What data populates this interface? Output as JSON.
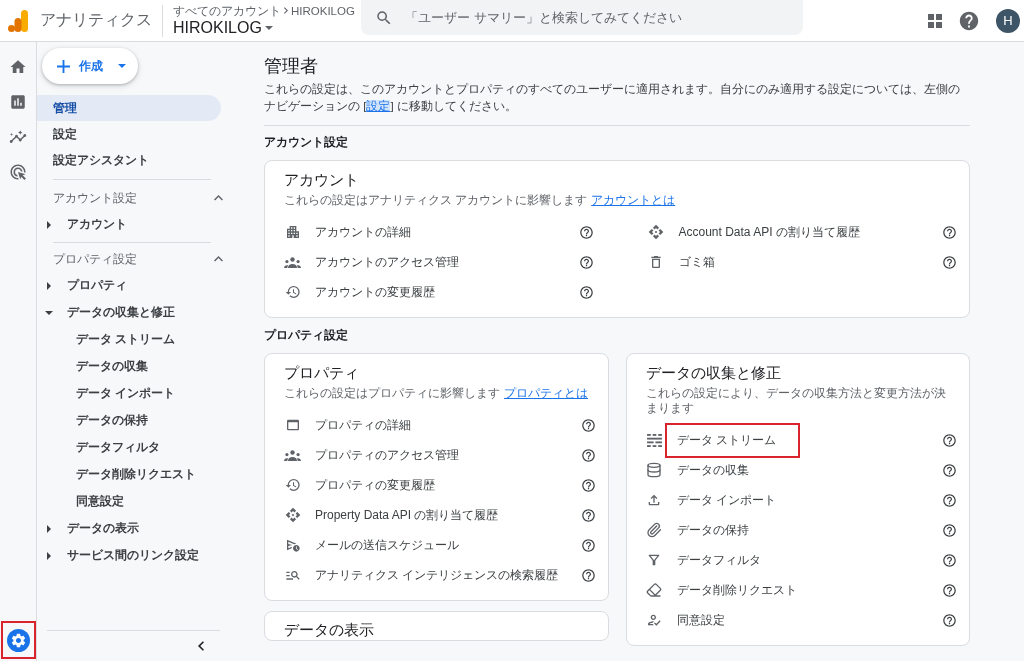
{
  "header": {
    "product": "アナリティクス",
    "breadcrumb": [
      "すべてのアカウント",
      "HIROKILOG"
    ],
    "property": "HIROKILOG",
    "search": {
      "placeholder": "「ユーザー サマリー」と検索してみてください"
    },
    "avatar": "H"
  },
  "rail": {
    "items": [
      {
        "kind": "home",
        "selected": false
      },
      {
        "kind": "reports",
        "selected": false
      },
      {
        "kind": "explore",
        "selected": false
      },
      {
        "kind": "advertising",
        "selected": false
      }
    ],
    "admin": {
      "selected": true,
      "highlighted": true
    }
  },
  "sidebar": {
    "create_button": "作成",
    "nav": [
      {
        "label": "管理",
        "selected": true
      },
      {
        "label": "設定",
        "selected": false
      },
      {
        "label": "設定アシスタント",
        "selected": false
      }
    ],
    "sections": [
      {
        "title": "アカウント設定",
        "expanded": true,
        "items": [
          {
            "label": "アカウント",
            "expanded": false
          }
        ]
      },
      {
        "title": "プロパティ設定",
        "expanded": true,
        "items": [
          {
            "label": "プロパティ",
            "expanded": false
          },
          {
            "label": "データの収集と修正",
            "expanded": true,
            "children": [
              {
                "label": "データ ストリーム",
                "selected": false
              },
              {
                "label": "データの収集",
                "selected": false
              },
              {
                "label": "データ インポート",
                "selected": false
              },
              {
                "label": "データの保持",
                "selected": false
              },
              {
                "label": "データフィルタ",
                "selected": false
              },
              {
                "label": "データ削除リクエスト",
                "selected": false
              },
              {
                "label": "同意設定",
                "selected": false
              }
            ]
          },
          {
            "label": "データの表示",
            "expanded": false
          },
          {
            "label": "サービス間のリンク設定",
            "expanded": false
          }
        ]
      }
    ]
  },
  "main": {
    "title": "管理者",
    "description": {
      "before": "これらの設定は、このアカウントとプロパティのすべてのユーザーに適用されます。自分にのみ適用する設定については、左側のナビゲーションの [",
      "link": "設定",
      "after": "] に移動してください。"
    },
    "sections": [
      {
        "heading": "アカウント設定",
        "columns": [
          [
            {
              "title": "アカウント",
              "description": "これらの設定はアナリティクス アカウントに影響します",
              "link": "アカウントとは",
              "columns": [
                [
                  {
                    "kind": "building",
                    "label": "アカウントの詳細",
                    "highlighted": false
                  },
                  {
                    "kind": "people",
                    "label": "アカウントのアクセス管理",
                    "highlighted": false
                  },
                  {
                    "kind": "history",
                    "label": "アカウントの変更履歴",
                    "highlighted": false
                  }
                ],
                [
                  {
                    "kind": "api",
                    "label": "Account Data API の割り当て履歴",
                    "highlighted": false
                  },
                  {
                    "kind": "trash",
                    "label": "ゴミ箱",
                    "highlighted": false
                  }
                ]
              ]
            }
          ]
        ]
      },
      {
        "heading": "プロパティ設定",
        "columns": [
          [
            {
              "title": "プロパティ",
              "description": "これらの設定はプロパティに影響します",
              "link": "プロパティとは",
              "columns": [
                [
                  {
                    "kind": "window",
                    "label": "プロパティの詳細",
                    "highlighted": false
                  },
                  {
                    "kind": "people",
                    "label": "プロパティのアクセス管理",
                    "highlighted": false
                  },
                  {
                    "kind": "history",
                    "label": "プロパティの変更履歴",
                    "highlighted": false
                  },
                  {
                    "kind": "api",
                    "label": "Property Data API の割り当て履歴",
                    "highlighted": false
                  },
                  {
                    "kind": "schedule-send",
                    "label": "メールの送信スケジュール",
                    "highlighted": false
                  },
                  {
                    "kind": "search-list",
                    "label": "アナリティクス インテリジェンスの検索履歴",
                    "highlighted": false
                  }
                ]
              ]
            },
            {
              "title": "データの表示"
            }
          ],
          [
            {
              "title": "データの収集と修正",
              "description": "これらの設定により、データの収集方法と変更方法が決まります",
              "columns": [
                [
                  {
                    "kind": "streams",
                    "label": "データ ストリーム",
                    "highlighted": true
                  },
                  {
                    "kind": "database",
                    "label": "データの収集",
                    "highlighted": false
                  },
                  {
                    "kind": "upload",
                    "label": "データ インポート",
                    "highlighted": false
                  },
                  {
                    "kind": "clip",
                    "label": "データの保持",
                    "highlighted": false
                  },
                  {
                    "kind": "filter",
                    "label": "データフィルタ",
                    "highlighted": false
                  },
                  {
                    "kind": "eraser",
                    "label": "データ削除リクエスト",
                    "highlighted": false
                  },
                  {
                    "kind": "person-check",
                    "label": "同意設定",
                    "highlighted": false
                  }
                ]
              ]
            }
          ]
        ]
      }
    ]
  }
}
